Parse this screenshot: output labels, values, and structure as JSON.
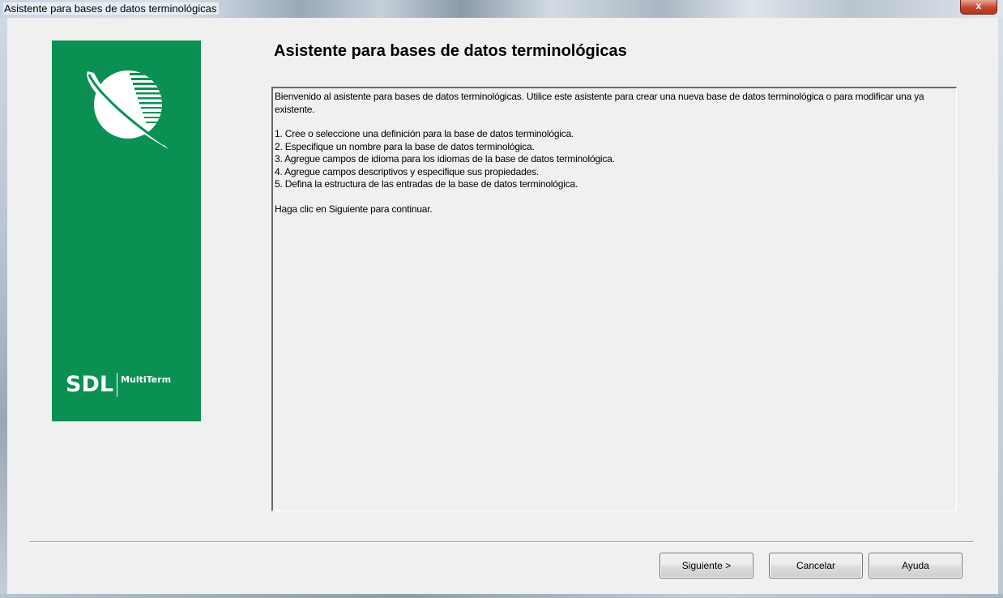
{
  "window": {
    "title": "Asistente para bases de datos terminológicas",
    "close_label": "x"
  },
  "banner": {
    "brand": "SDL",
    "product": "MultiTerm",
    "color": "#0b9054"
  },
  "page": {
    "heading": "Asistente para bases de datos terminológicas",
    "intro": "Bienvenido al asistente para bases de datos terminológicas. Utilice este asistente para crear una nueva base de datos terminológica o para modificar una ya existente.",
    "steps": [
      "1. Cree o seleccione una definición para la base de datos terminológica.",
      "2. Especifique un nombre para la base de datos terminológica.",
      "3. Agregue campos de idioma para los idiomas de la base de datos terminológica.",
      "4. Agregue campos descriptivos y especifique sus propiedades.",
      "5. Defina la estructura de las entradas de la base de datos terminológica."
    ],
    "closing": "Haga clic en Siguiente para continuar."
  },
  "buttons": {
    "next": "Siguiente >",
    "cancel": "Cancelar",
    "help": "Ayuda"
  },
  "icons": {
    "close": "close-icon",
    "logo": "globe-logo-icon"
  }
}
